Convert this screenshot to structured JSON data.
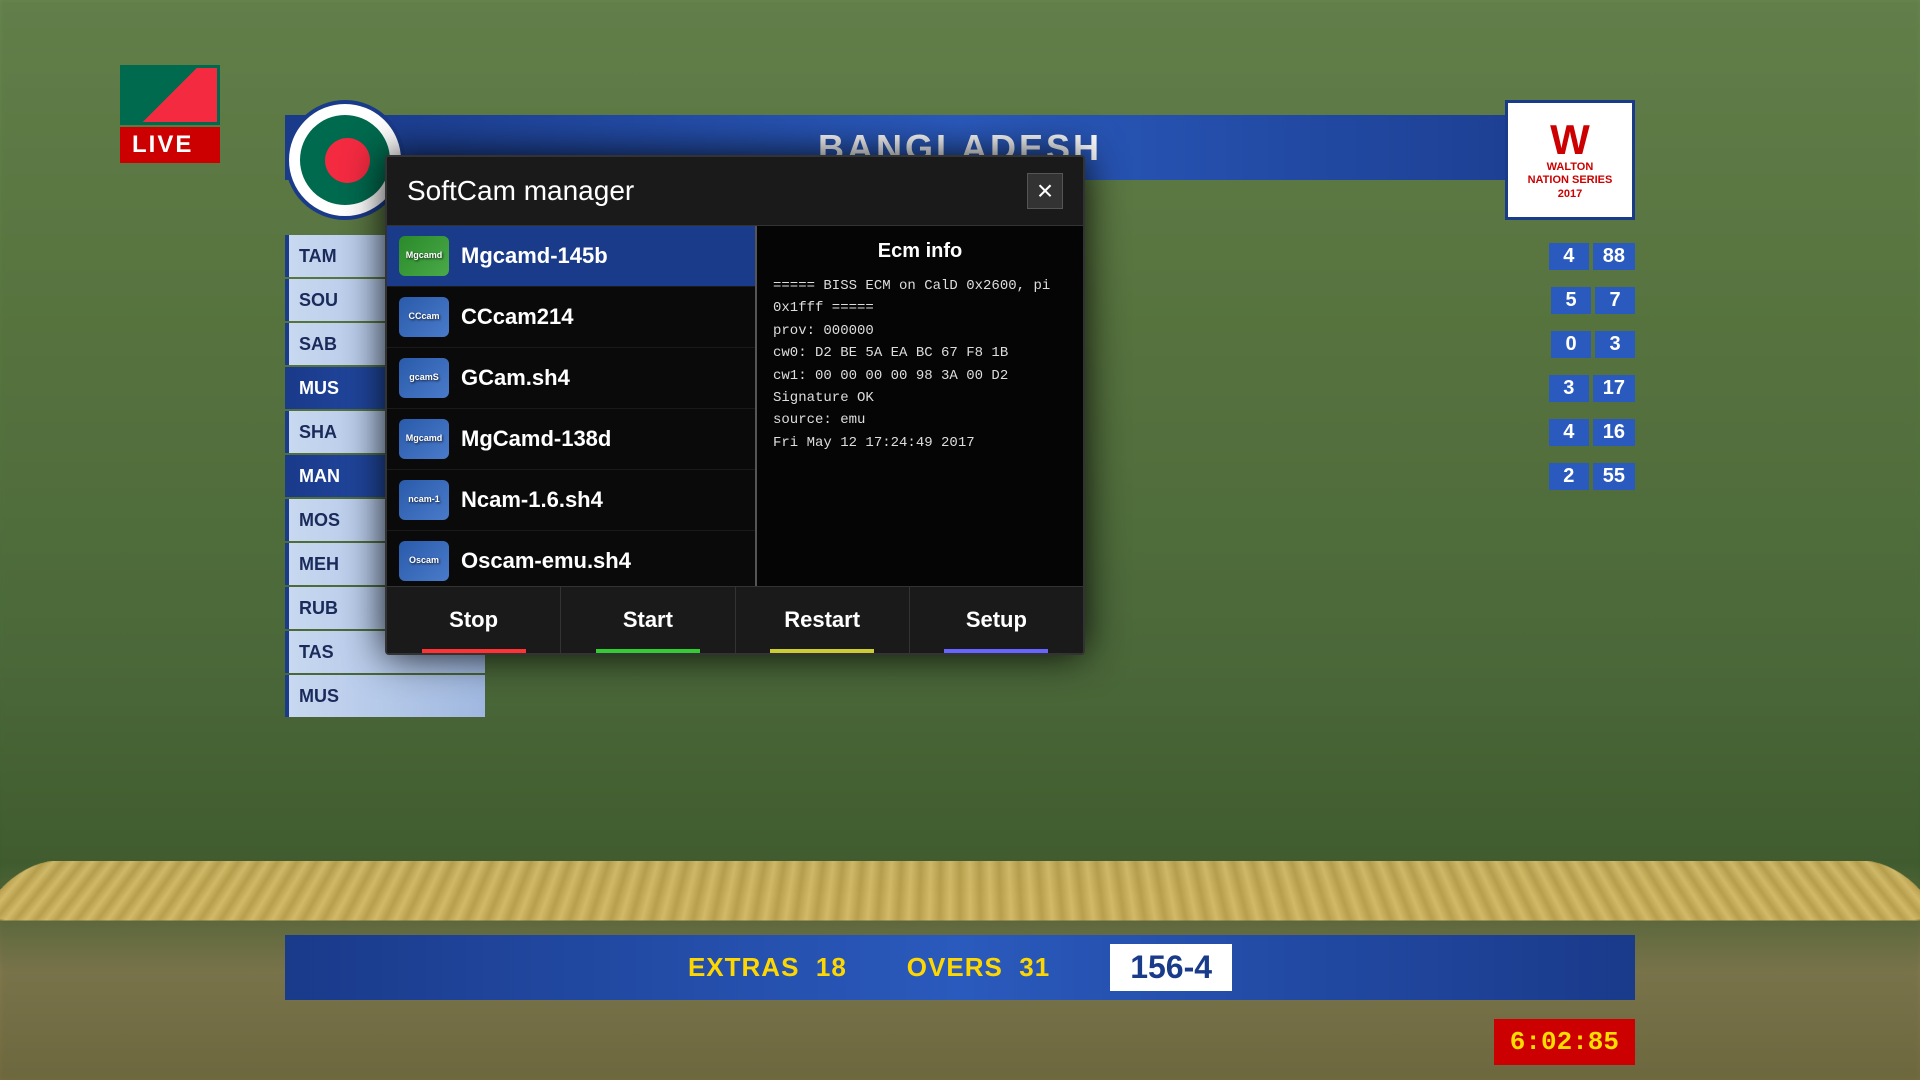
{
  "background": {
    "description": "Cricket field background"
  },
  "topBar": {
    "team": "BANGLADESH"
  },
  "liveLabel": "LIVE",
  "walton": {
    "letter": "W",
    "subtext": "WALTON\nNATION SERIES\n2017"
  },
  "scoreRows": [
    {
      "label": "TAM",
      "score1": "4",
      "score2": "88"
    },
    {
      "label": "SOU",
      "score1": "5",
      "score2": "7"
    },
    {
      "label": "SAB",
      "score1": "0",
      "score2": "3"
    },
    {
      "label": "MUS",
      "score1": "3",
      "score2": "17",
      "blue": true
    },
    {
      "label": "SHA",
      "score1": "4",
      "score2": "16"
    },
    {
      "label": "MAN",
      "score1": "2",
      "score2": "55",
      "blue": true
    },
    {
      "label": "MOS",
      "score1": "",
      "score2": ""
    },
    {
      "label": "MEH",
      "score1": "",
      "score2": ""
    },
    {
      "label": "RUB",
      "score1": "",
      "score2": ""
    },
    {
      "label": "TAS",
      "score1": "",
      "score2": ""
    },
    {
      "label": "MUS",
      "score1": "",
      "score2": ""
    }
  ],
  "bottomBar": {
    "extras_label": "EXTRAS",
    "extras_value": "18",
    "overs_label": "OVERS",
    "overs_value": "31",
    "score": "156-4"
  },
  "timer": {
    "value": "6:02:85"
  },
  "dialog": {
    "title": "SoftCam manager",
    "close_label": "×",
    "ecm": {
      "title": "Ecm info",
      "lines": [
        "===== BISS ECM on CalD 0x2600, pi",
        "0x1fff =====",
        "prov: 000000",
        "cw0: D2 BE 5A EA BC 67 F8 1B",
        "cw1: 00 00 00 00 98 3A 00 D2",
        "Signature OK",
        "source: emu",
        "Fri May 12 17:24:49 2017"
      ]
    },
    "cams": [
      {
        "id": "mgcamd-145b",
        "name": "Mgcamd-145b",
        "icon_label": "Mgcamd",
        "color": "green",
        "selected": true
      },
      {
        "id": "cccam214",
        "name": "CCcam214",
        "icon_label": "CCcam",
        "color": "blue",
        "selected": false
      },
      {
        "id": "gcam-sh4",
        "name": "GCam.sh4",
        "icon_label": "gcamS",
        "color": "blue",
        "selected": false
      },
      {
        "id": "mgcamd-138d",
        "name": "MgCamd-138d",
        "icon_label": "Mgcamd",
        "color": "blue",
        "selected": false
      },
      {
        "id": "ncam-16sh4",
        "name": "Ncam-1.6.sh4",
        "icon_label": "ncam-1",
        "color": "blue",
        "selected": false
      },
      {
        "id": "oscam-emu",
        "name": "Oscam-emu.sh4",
        "icon_label": "Oscam",
        "color": "blue",
        "selected": false
      }
    ],
    "actions": [
      {
        "id": "stop",
        "label": "Stop",
        "style": "stop"
      },
      {
        "id": "start",
        "label": "Start",
        "style": "start"
      },
      {
        "id": "restart",
        "label": "Restart",
        "style": "restart"
      },
      {
        "id": "setup",
        "label": "Setup",
        "style": "setup"
      }
    ]
  }
}
